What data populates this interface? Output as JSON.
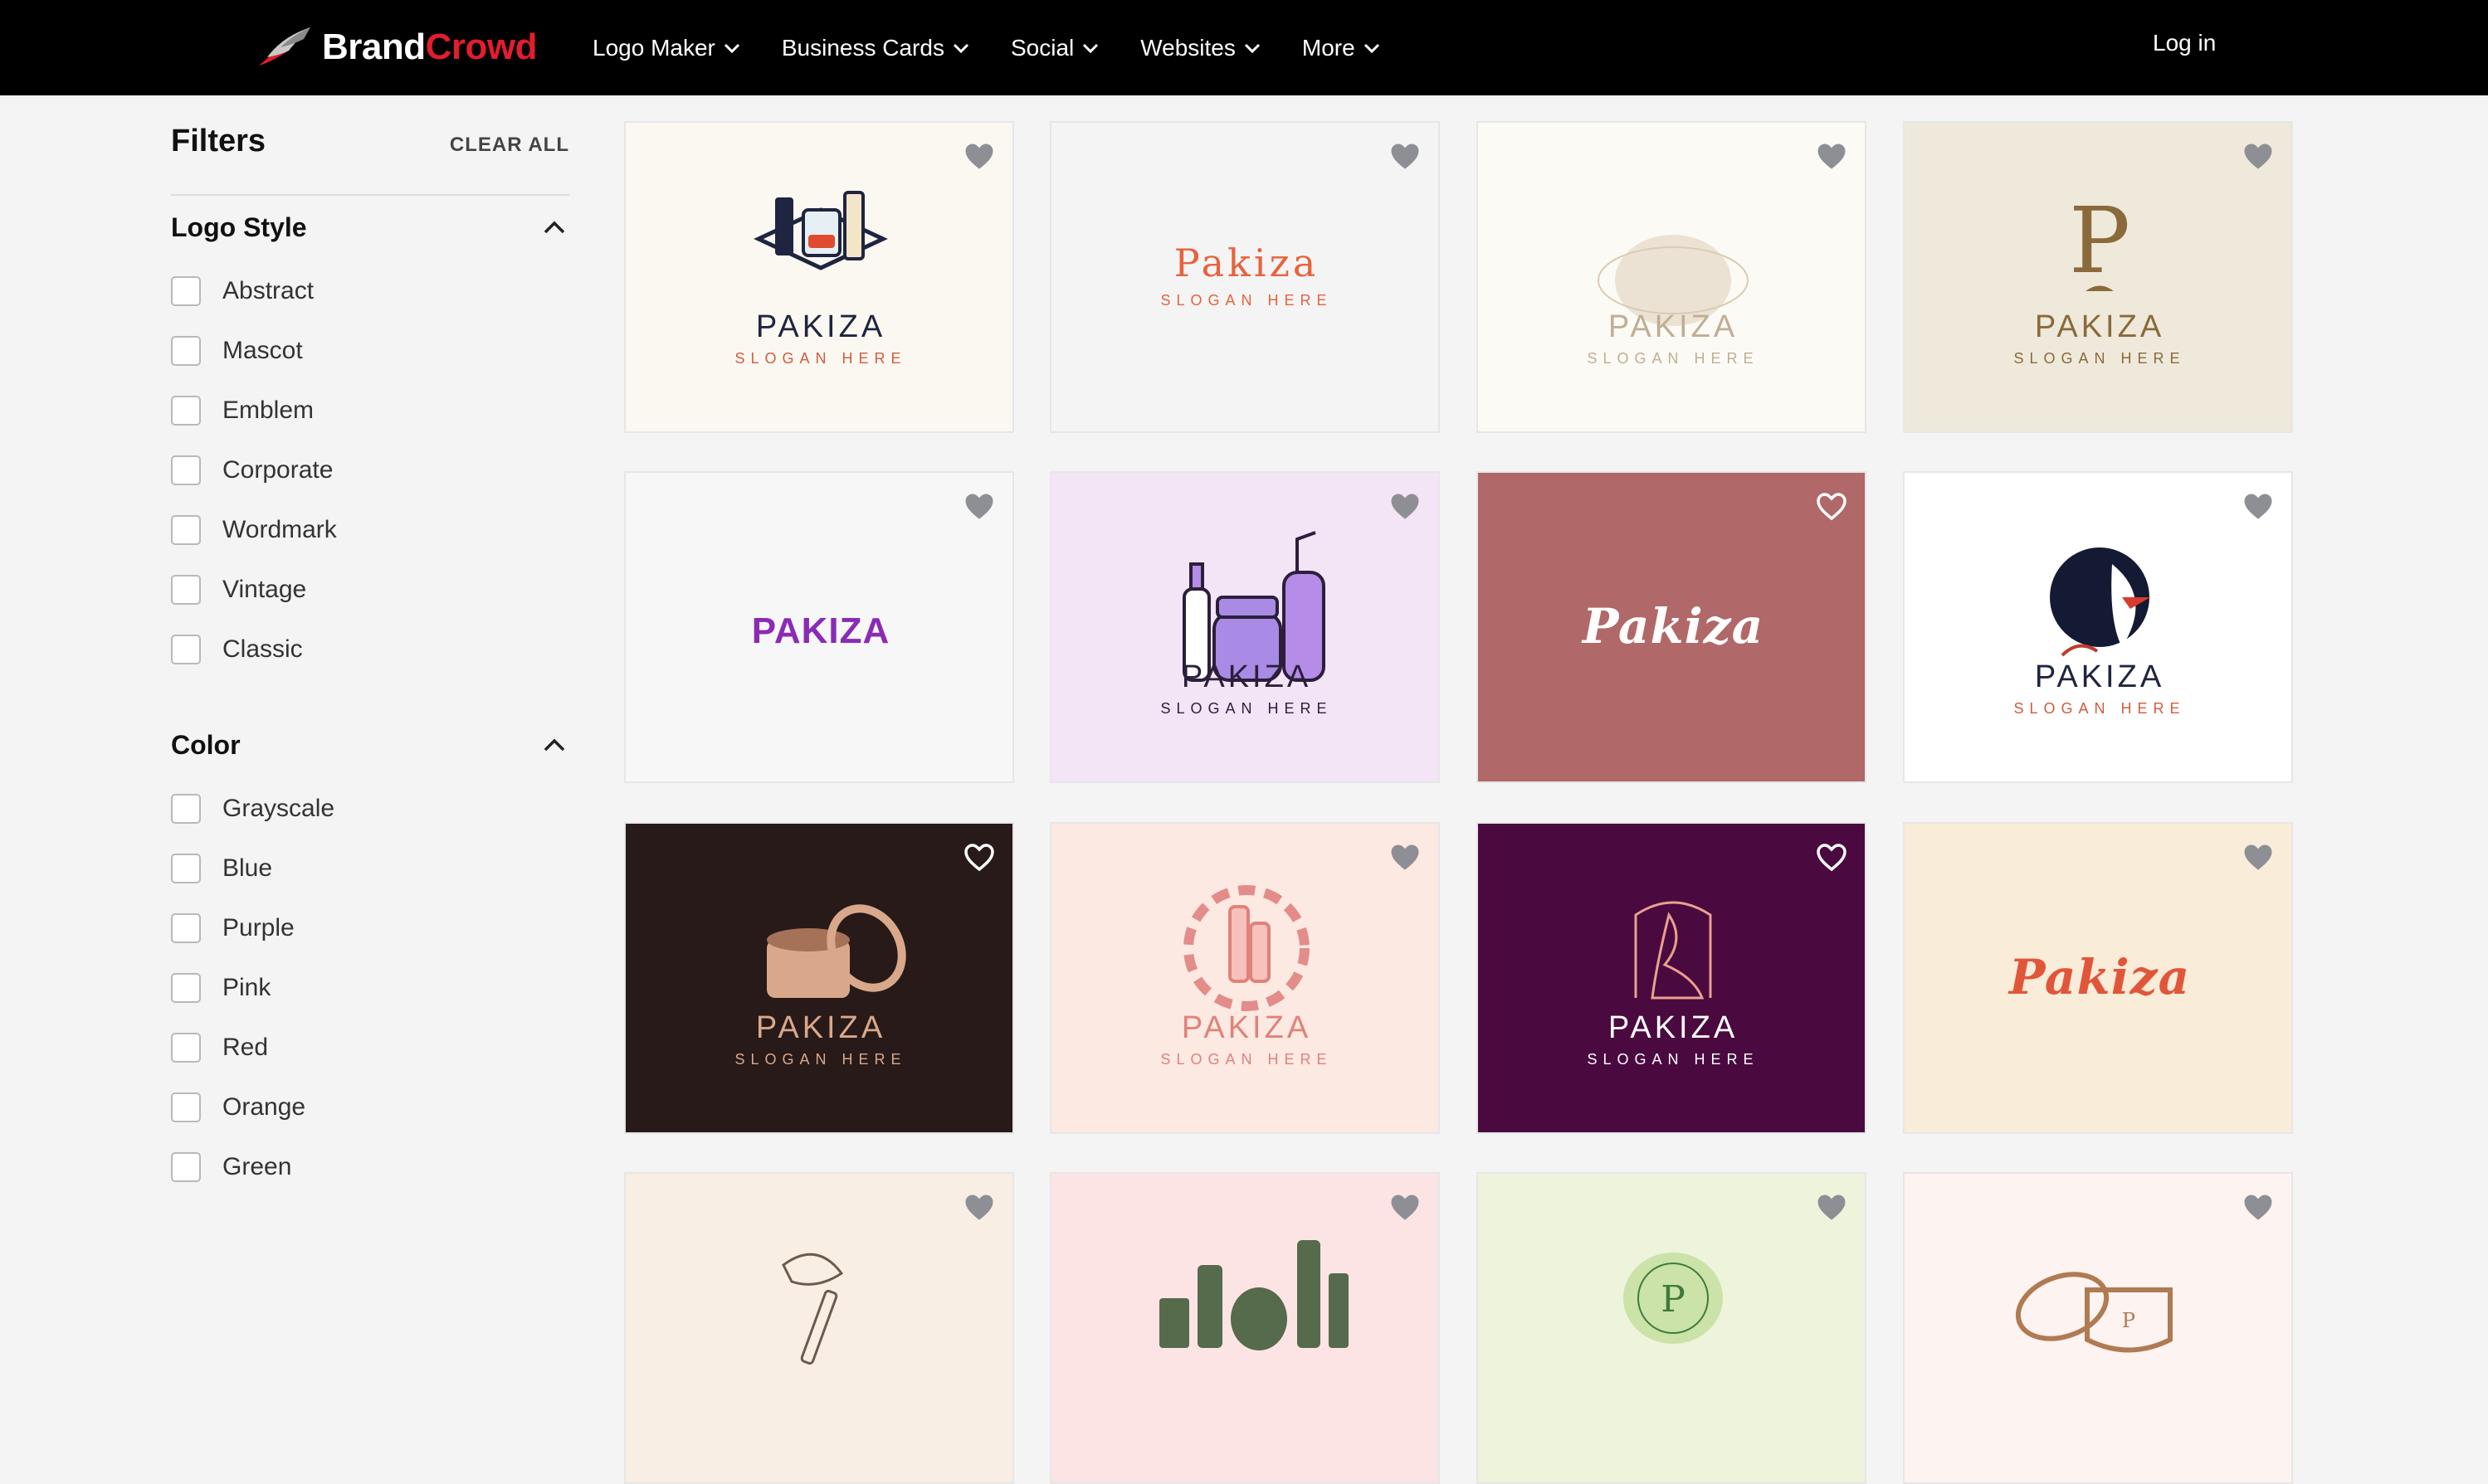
{
  "brand": {
    "name_a": "Brand",
    "name_b": "Crowd",
    "accent": "#e11d2e"
  },
  "nav": [
    {
      "label": "Logo Maker"
    },
    {
      "label": "Business Cards"
    },
    {
      "label": "Social"
    },
    {
      "label": "Websites"
    },
    {
      "label": "More"
    }
  ],
  "login_label": "Log in",
  "filters": {
    "title": "Filters",
    "clear_all": "CLEAR ALL",
    "logo_style": {
      "title": "Logo Style",
      "options": [
        "Abstract",
        "Mascot",
        "Emblem",
        "Corporate",
        "Wordmark",
        "Vintage",
        "Classic"
      ]
    },
    "color": {
      "title": "Color",
      "options": [
        "Grayscale",
        "Blue",
        "Purple",
        "Pink",
        "Red",
        "Orange",
        "Green"
      ]
    }
  },
  "logos": [
    {
      "bg": "#fbf8f2",
      "name": "PAKIZA",
      "slogan": "SLOGAN HERE",
      "name_color": "#1f2540",
      "slogan_color": "#d45b3c",
      "icon": "cosmetics-kit-icon"
    },
    {
      "bg": "#f4f4f5",
      "name": "Pakiza",
      "slogan": "SLOGAN HERE",
      "name_color": "#e8623c",
      "slogan_color": "#e8623c",
      "icon": ""
    },
    {
      "bg": "#fcfaf4",
      "name": "PAKIZA",
      "slogan": "SLOGAN HERE",
      "name_color": "#bfae95",
      "slogan_color": "#bfae95",
      "icon": "watercolor-splash-icon"
    },
    {
      "bg": "#efe9dc",
      "name": "PAKIZA",
      "slogan": "SLOGAN HERE",
      "name_color": "#8a6a3a",
      "slogan_color": "#8a6a3a",
      "icon": "letter-p-monogram-icon"
    },
    {
      "bg": "#f7f7f8",
      "name": "PAKIZA",
      "slogan": "",
      "name_color": "#8a2bb5",
      "slogan_color": "#8a2bb5",
      "icon": ""
    },
    {
      "bg": "#f3e4f6",
      "name": "PAKIZA",
      "slogan": "SLOGAN HERE",
      "name_color": "#2b1f3a",
      "slogan_color": "#2b1f3a",
      "icon": "cosmetic-bottles-icon"
    },
    {
      "bg": "#b06868",
      "name": "Pakiza",
      "slogan": "",
      "name_color": "#ffffff",
      "slogan_color": "#ffffff",
      "icon": ""
    },
    {
      "bg": "#ffffff",
      "name": "PAKIZA",
      "slogan": "SLOGAN HERE",
      "name_color": "#1f2540",
      "slogan_color": "#d45b3c",
      "icon": "woman-face-icon"
    },
    {
      "bg": "#271a18",
      "name": "PAKIZA",
      "slogan": "SLOGAN HERE",
      "name_color": "#d9a88b",
      "slogan_color": "#d9a88b",
      "icon": "cream-jar-icon"
    },
    {
      "bg": "#fce9e2",
      "name": "PAKIZA",
      "slogan": "SLOGAN HERE",
      "name_color": "#e0827a",
      "slogan_color": "#e0827a",
      "icon": "cosmetics-wreath-icon"
    },
    {
      "bg": "#4a0a3f",
      "name": "PAKIZA",
      "slogan": "SLOGAN HERE",
      "name_color": "#ffffff",
      "slogan_color": "#ffffff",
      "icon": "woman-silhouette-icon"
    },
    {
      "bg": "#f9ecd8",
      "name": "Pakiza",
      "slogan": "",
      "name_color": "#e1563a",
      "slogan_color": "#e1563a",
      "icon": ""
    },
    {
      "bg": "#f8eee4",
      "name": "",
      "slogan": "",
      "name_color": "#6b5a4e",
      "slogan_color": "#6b5a4e",
      "icon": "brush-dropper-icon"
    },
    {
      "bg": "#fde4e4",
      "name": "",
      "slogan": "",
      "name_color": "#566a4c",
      "slogan_color": "#566a4c",
      "icon": "cosmetic-products-icon"
    },
    {
      "bg": "#eef3dc",
      "name": "",
      "slogan": "",
      "name_color": "#3e7a3c",
      "slogan_color": "#3e7a3c",
      "icon": "leaf-emblem-icon"
    },
    {
      "bg": "#fdf3f1",
      "name": "",
      "slogan": "",
      "name_color": "#b07a52",
      "slogan_color": "#b07a52",
      "icon": "open-jar-icon"
    }
  ]
}
